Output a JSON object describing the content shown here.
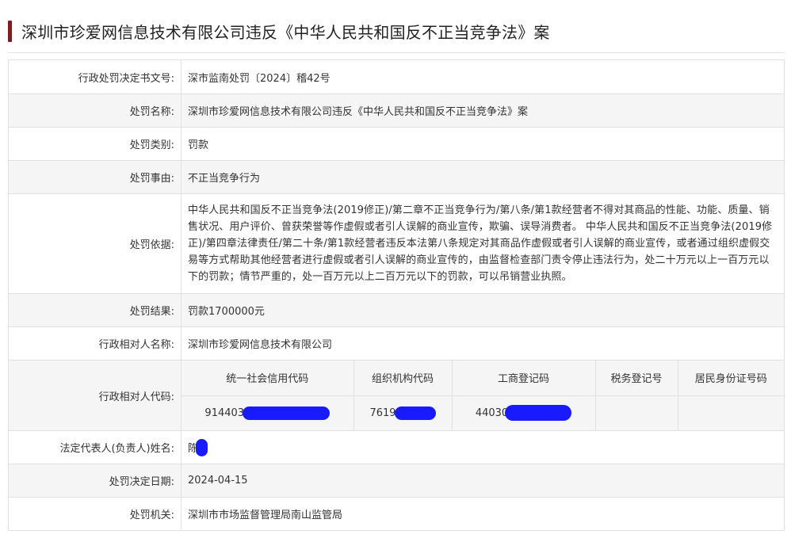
{
  "title": "深圳市珍爱网信息技术有限公司违反《中华人民共和国反不正当竞争法》案",
  "colors": {
    "accent": "#7a1f1f",
    "redaction": "#1a1aff",
    "row_alt": "#f5f5f5"
  },
  "rows": {
    "doc_no": {
      "label": "行政处罚决定书文号:",
      "value": "深市监南处罚〔2024〕稽42号"
    },
    "case_name": {
      "label": "处罚名称:",
      "value": "深圳市珍爱网信息技术有限公司违反《中华人民共和国反不正当竞争法》案"
    },
    "category": {
      "label": "处罚类别:",
      "value": "罚款"
    },
    "reason": {
      "label": "处罚事由:",
      "value": "不正当竞争行为"
    },
    "basis": {
      "label": "处罚依据:",
      "value": "中华人民共和国反不正当竞争法(2019修正)/第二章不正当竞争行为/第八条/第1款经营者不得对其商品的性能、功能、质量、销售状况、用户评价、曾获荣誉等作虚假或者引人误解的商业宣传，欺骗、误导消费者。 中华人民共和国反不正当竞争法(2019修正)/第四章法律责任/第二十条/第1款经营者违反本法第八条规定对其商品作虚假或者引人误解的商业宣传，或者通过组织虚假交易等方式帮助其他经营者进行虚假或者引人误解的商业宣传的，由监督检查部门责令停止违法行为，处二十万元以上一百万元以下的罚款；情节严重的，处一百万元以上二百万元以下的罚款，可以吊销营业执照。"
    },
    "result": {
      "label": "处罚结果:",
      "value": "罚款1700000元"
    },
    "party_name": {
      "label": "行政相对人名称:",
      "value": "深圳市珍爱网信息技术有限公司"
    },
    "party_code": {
      "label": "行政相对人代码:",
      "headers": [
        "统一社会信用代码",
        "组织机构代码",
        "工商登记码",
        "税务登记号",
        "居民身份证号码"
      ],
      "values": [
        "914403",
        "7619",
        "44030",
        "",
        ""
      ]
    },
    "legal_rep": {
      "label": "法定代表人(负责人)姓名:",
      "value": "陈"
    },
    "decision_date": {
      "label": "处罚决定日期:",
      "value": "2024-04-15"
    },
    "authority": {
      "label": "处罚机关:",
      "value": "深圳市市场监督管理局南山监管局"
    }
  }
}
